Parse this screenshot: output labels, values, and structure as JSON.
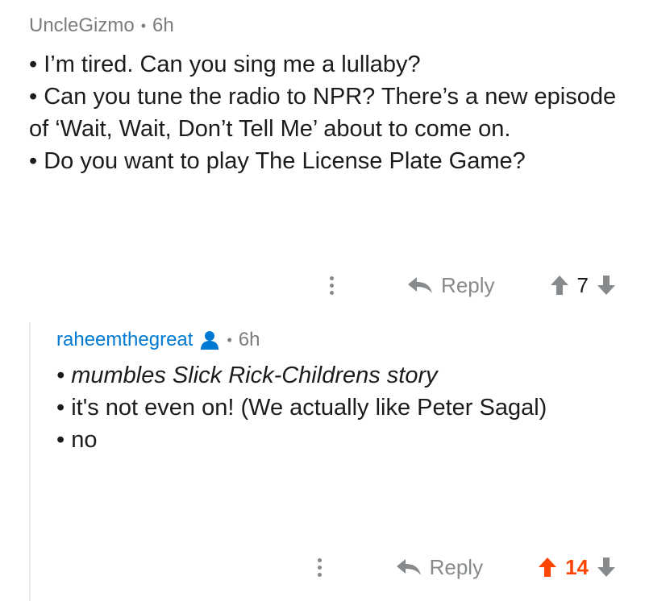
{
  "comments": [
    {
      "author": "UncleGizmo",
      "time": "6h",
      "lines": [
        "• I’m tired. Can you sing me a lullaby?",
        "• Can you tune the radio to NPR? There’s a new episode of ‘Wait, Wait, Don’t Tell Me’ about to come on.",
        "• Do you want to play The License Plate Game?"
      ],
      "reply_label": "Reply",
      "score": "7",
      "upvoted": false
    },
    {
      "author": "raheemthegreat",
      "time": "6h",
      "lines": [
        "• mumbles Slick Rick-Childrens story",
        "• it's not even on! (We actually like Peter Sagal)",
        "• no"
      ],
      "reply_label": "Reply",
      "score": "14",
      "upvoted": true
    }
  ],
  "colors": {
    "username_link": "#0079d3",
    "upvote_active": "#ff4500",
    "muted": "#878a8c"
  },
  "icons": {
    "more": "more-options-icon",
    "reply": "reply-arrow-icon",
    "upvote": "upvote-arrow-icon",
    "downvote": "downvote-arrow-icon",
    "op": "person-icon"
  }
}
